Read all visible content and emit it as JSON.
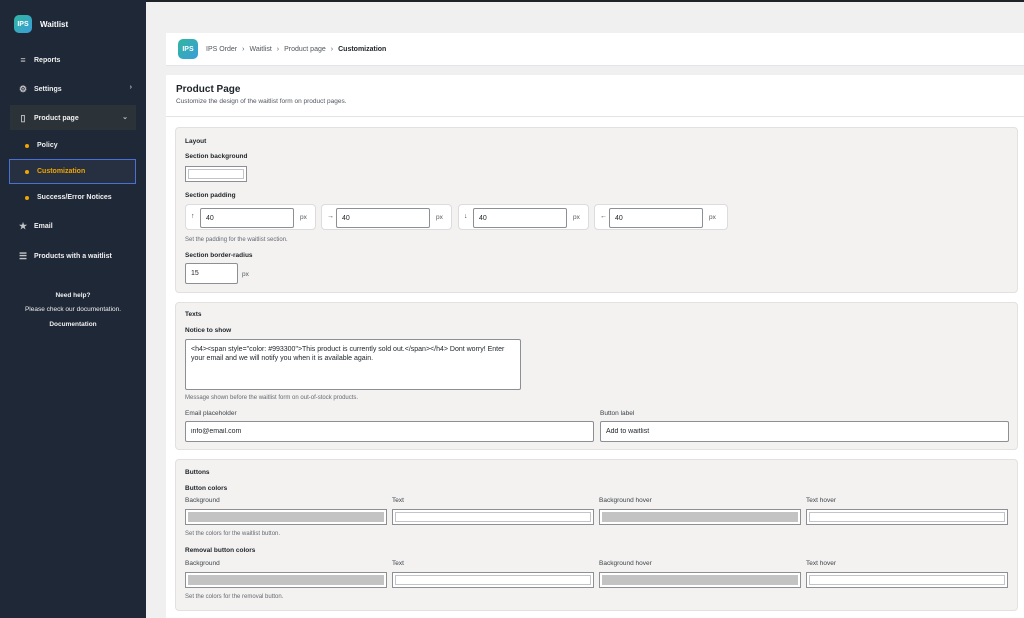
{
  "app": {
    "logo_text": "IPS",
    "name": "Waitlist"
  },
  "sidebar": {
    "items": [
      {
        "label": "Reports"
      },
      {
        "label": "Settings",
        "chevron": "›"
      },
      {
        "label": "Product page",
        "chevron": "⌄"
      },
      {
        "label": "Email"
      },
      {
        "label": "Products with a waitlist"
      }
    ],
    "sub_items": [
      {
        "label": "Policy"
      },
      {
        "label": "Customization"
      },
      {
        "label": "Success/Error Notices"
      }
    ],
    "help": {
      "title": "Need help?",
      "text": "Please check our documentation.",
      "link": "Documentation"
    }
  },
  "breadcrumb": {
    "logo_text": "IPS",
    "items": [
      "IPS Order",
      "Waitlist",
      "Product page"
    ],
    "current": "Customization",
    "separator": "›"
  },
  "page": {
    "title": "Product Page",
    "subtitle": "Customize the design of the waitlist form on product pages."
  },
  "layout": {
    "title": "Layout",
    "bg_label": "Section background",
    "padding_label": "Section padding",
    "padding": [
      {
        "arrow": "↑",
        "value": "40",
        "unit": "px"
      },
      {
        "arrow": "→",
        "value": "40",
        "unit": "px"
      },
      {
        "arrow": "↓",
        "value": "40",
        "unit": "px"
      },
      {
        "arrow": "←",
        "value": "40",
        "unit": "px"
      }
    ],
    "padding_hint": "Set the padding for the waitlist section.",
    "radius_label": "Section border-radius",
    "radius_value": "15",
    "radius_unit": "px"
  },
  "texts": {
    "title": "Texts",
    "notice_label": "Notice to show",
    "notice_value": "<h4><span style=\"color: #993300\">This product is currently sold out.</span></h4> Dont worry! Enter your email and we will notify you when it is available again.",
    "notice_hint": "Message shown before the waitlist form on out-of-stock products.",
    "email_label": "Email placeholder",
    "email_value": "info@email.com",
    "button_label": "Button label",
    "button_value": "Add to waitlist"
  },
  "buttons": {
    "title": "Buttons",
    "colors_label": "Button colors",
    "columns": [
      "Background",
      "Text",
      "Background hover",
      "Text hover"
    ],
    "colors_hint": "Set the colors for the waitlist button.",
    "removal_label": "Removal button colors",
    "removal_hint": "Set the colors for the removal button."
  },
  "colors": {
    "swatch_grey": "#c3c3c3",
    "swatch_white": "#ffffff",
    "accent": "#f0a500",
    "sidebar_bg": "#1f2836"
  }
}
